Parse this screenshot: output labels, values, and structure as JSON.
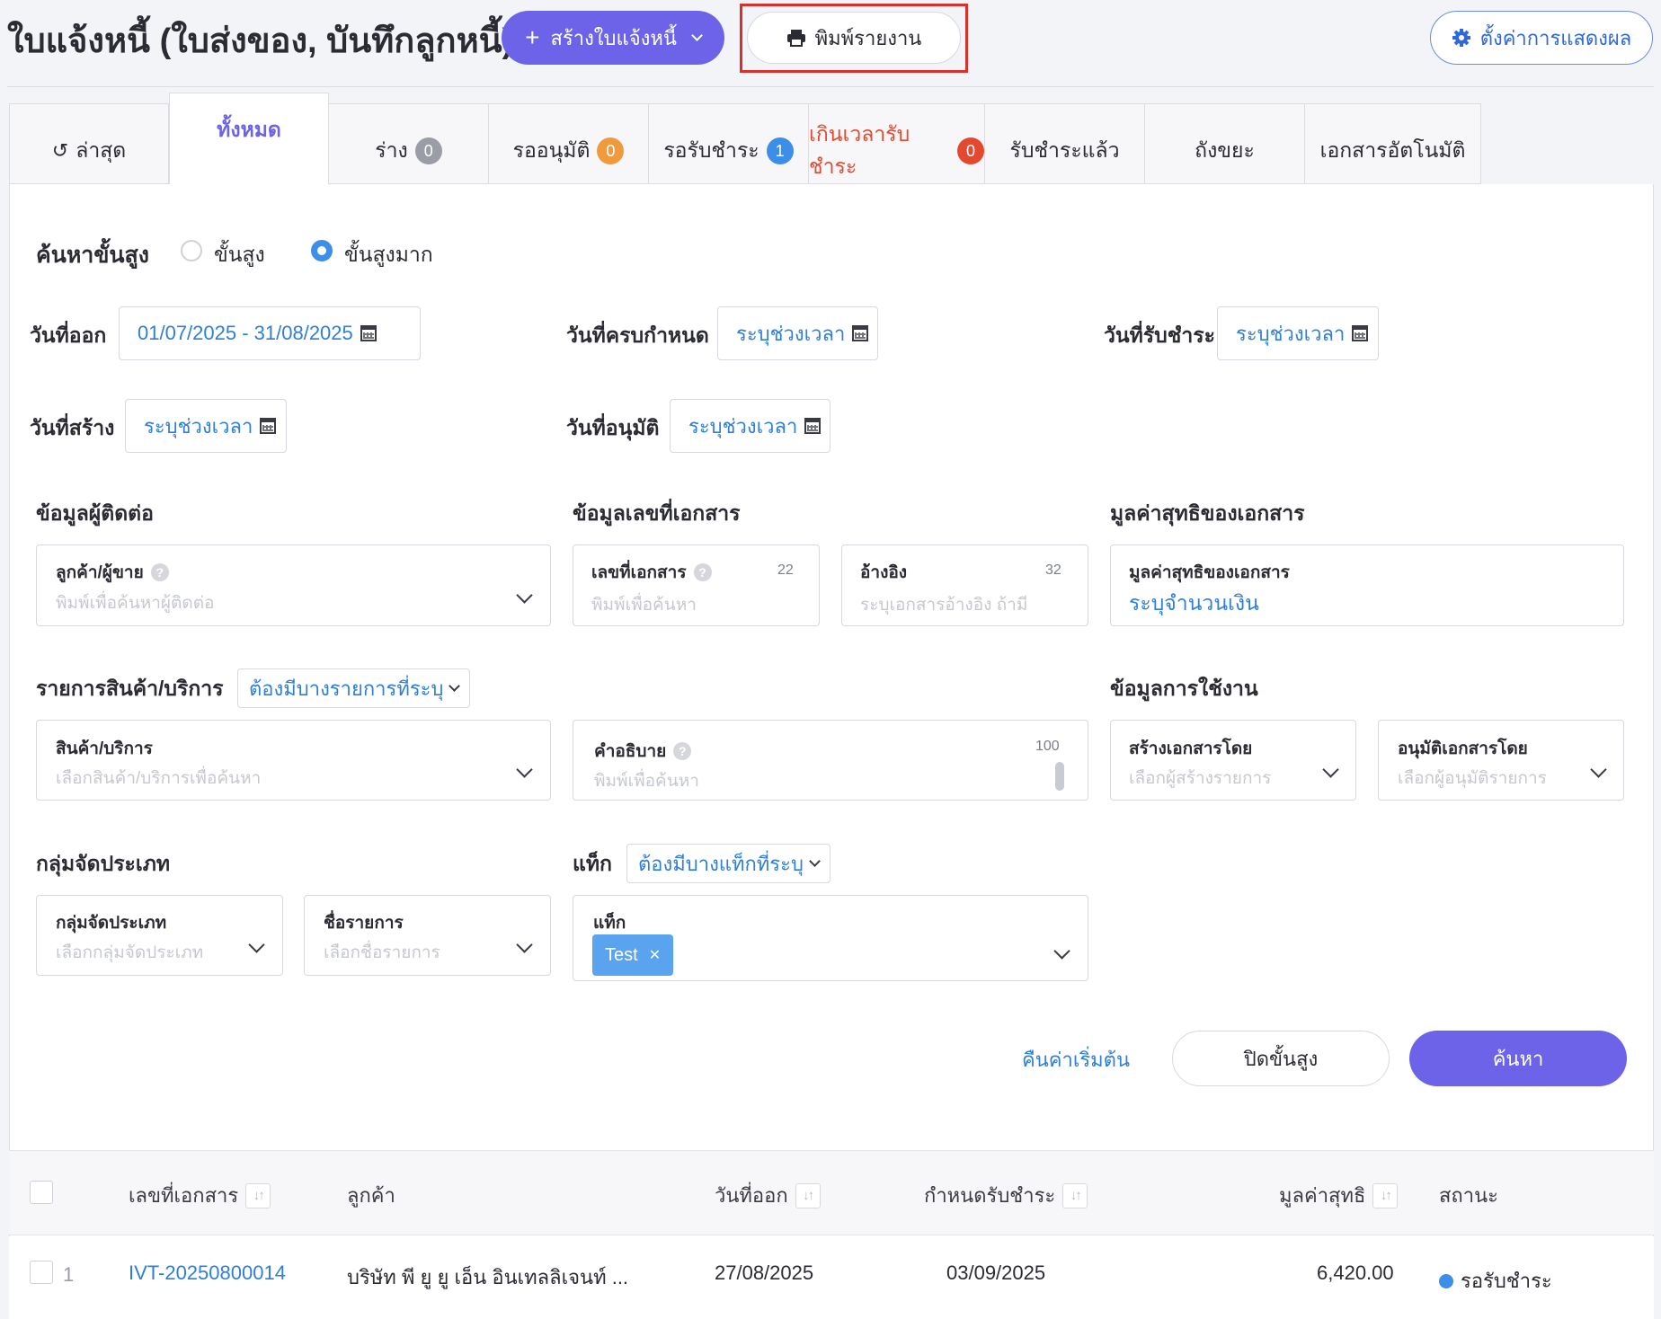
{
  "header": {
    "title": "ใบแจ้งหนี้ (ใบส่งของ, บันทึกลูกหนี้)",
    "create_button": "สร้างใบแจ้งหนี้",
    "print_button": "พิมพ์รายงาน",
    "settings_button": "ตั้งค่าการแสดงผล"
  },
  "tabs": [
    {
      "label": "ล่าสุด",
      "icon": "history-icon"
    },
    {
      "label": "ทั้งหมด",
      "active": true
    },
    {
      "label": "ร่าง",
      "badge": "0",
      "badge_color": "#9b9da6"
    },
    {
      "label": "รออนุมัติ",
      "badge": "0",
      "badge_color": "#f09a3e"
    },
    {
      "label": "รอรับชำระ",
      "badge": "1",
      "badge_color": "#3d8ee8"
    },
    {
      "label": "เกินเวลารับชำระ",
      "badge": "0",
      "badge_color": "#e2492f"
    },
    {
      "label": "รับชำระแล้ว"
    },
    {
      "label": "ถังขยะ"
    },
    {
      "label": "เอกสารอัตโนมัติ"
    }
  ],
  "search": {
    "title": "ค้นหาขั้นสูง",
    "mode_advanced": "ขั้นสูง",
    "mode_very_advanced": "ขั้นสูงมาก",
    "selected_mode": "ขั้นสูงมาก"
  },
  "dates": {
    "issue_label": "วันที่ออก",
    "issue_value": "01/07/2025 - 31/08/2025",
    "due_label": "วันที่ครบกำหนด",
    "due_value": "ระบุช่วงเวลา",
    "paid_label": "วันที่รับชำระ",
    "paid_value": "ระบุช่วงเวลา",
    "created_label": "วันที่สร้าง",
    "created_value": "ระบุช่วงเวลา",
    "approved_label": "วันที่อนุมัติ",
    "approved_value": "ระบุช่วงเวลา"
  },
  "contact": {
    "section": "ข้อมูลผู้ติดต่อ",
    "field_label": "ลูกค้า/ผู้ขาย",
    "placeholder": "พิมพ์เพื่อค้นหาผู้ติดต่อ"
  },
  "docnum": {
    "section": "ข้อมูลเลขที่เอกสาร",
    "number_label": "เลขที่เอกสาร",
    "number_count": "22",
    "number_placeholder": "พิมพ์เพื่อค้นหา",
    "ref_label": "อ้างอิง",
    "ref_count": "32",
    "ref_placeholder": "ระบุเอกสารอ้างอิง ถ้ามี"
  },
  "net_value": {
    "section": "มูลค่าสุทธิของเอกสาร",
    "field_label": "มูลค่าสุทธิของเอกสาร",
    "value": "ระบุจำนวนเงิน"
  },
  "items": {
    "section": "รายการสินค้า/บริการ",
    "filter": "ต้องมีบางรายการที่ระบุ",
    "field_label": "สินค้า/บริการ",
    "placeholder": "เลือกสินค้า/บริการเพื่อค้นหา"
  },
  "description": {
    "field_label": "คำอธิบาย",
    "count": "100",
    "placeholder": "พิมพ์เพื่อค้นหา"
  },
  "usage": {
    "section": "ข้อมูลการใช้งาน",
    "created_by_label": "สร้างเอกสารโดย",
    "created_by_placeholder": "เลือกผู้สร้างรายการ",
    "approved_by_label": "อนุมัติเอกสารโดย",
    "approved_by_placeholder": "เลือกผู้อนุมัติรายการ"
  },
  "category": {
    "section": "กลุ่มจัดประเภท",
    "group_label": "กลุ่มจัดประเภท",
    "group_placeholder": "เลือกกลุ่มจัดประเภท",
    "name_label": "ชื่อรายการ",
    "name_placeholder": "เลือกชื่อรายการ"
  },
  "tags": {
    "section": "แท็ก",
    "filter": "ต้องมีบางแท็กที่ระบุ",
    "field_label": "แท็ก",
    "selected": [
      "Test"
    ]
  },
  "actions": {
    "reset": "คืนค่าเริ่มต้น",
    "close": "ปิดขั้นสูง",
    "search": "ค้นหา"
  },
  "table": {
    "columns": [
      "เลขที่เอกสาร",
      "ลูกค้า",
      "วันที่ออก",
      "กำหนดรับชำระ",
      "มูลค่าสุทธิ",
      "สถานะ"
    ],
    "rows": [
      {
        "index": "1",
        "doc_number": "IVT-20250800014",
        "customer": "บริษัท พี ยู ยู เอ็น อินเทลลิเจนท์ ...",
        "issue_date": "27/08/2025",
        "due_date": "03/09/2025",
        "net_value": "6,420.00",
        "status": "รอรับชำระ",
        "status_color": "#3d8ee8"
      }
    ]
  },
  "colors": {
    "primary": "#6c63e8",
    "link": "#2f7fd8",
    "highlight_box": "#d9302c",
    "overdue": "#e2492f"
  }
}
